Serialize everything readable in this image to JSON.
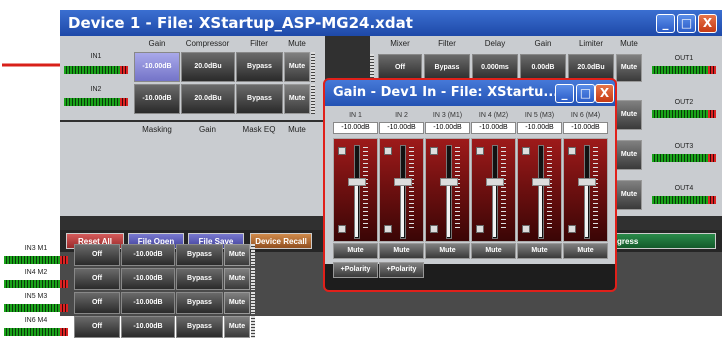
{
  "main_window": {
    "title": "Device 1  -  File: XStartup_ASP-MG24.xdat",
    "controls": {
      "minimize": "_",
      "maximize": "□",
      "close": "X"
    }
  },
  "input_section": {
    "headers": [
      "Gain",
      "Compressor",
      "Filter",
      "Mute"
    ],
    "rows": [
      {
        "name": "IN1",
        "gain": "-10.00dB",
        "compressor": "20.0dBu",
        "filter": "Bypass",
        "mute": "Mute"
      },
      {
        "name": "IN2",
        "gain": "-10.00dB",
        "compressor": "20.0dBu",
        "filter": "Bypass",
        "mute": "Mute"
      }
    ]
  },
  "mic_section": {
    "headers": [
      "Masking",
      "Gain",
      "Mask EQ",
      "Mute"
    ],
    "rows": [
      {
        "name": "IN3 M1",
        "masking": "Off",
        "gain": "-10.00dB",
        "mask_eq": "Bypass",
        "mute": "Mute"
      },
      {
        "name": "IN4 M2",
        "masking": "Off",
        "gain": "-10.00dB",
        "mask_eq": "Bypass",
        "mute": "Mute"
      },
      {
        "name": "IN5 M3",
        "masking": "Off",
        "gain": "-10.00dB",
        "mask_eq": "Bypass",
        "mute": "Mute"
      },
      {
        "name": "IN6 M4",
        "masking": "Off",
        "gain": "-10.00dB",
        "mask_eq": "Bypass",
        "mute": "Mute"
      }
    ]
  },
  "output_section": {
    "headers": [
      "Mixer",
      "Filter",
      "Delay",
      "Gain",
      "Limiter",
      "Mute"
    ],
    "row1": {
      "mixer": "Off",
      "filter": "Bypass",
      "delay": "0.000ms",
      "gain": "0.00dB",
      "limiter": "20.0dBu",
      "mute": "Mute"
    },
    "partial_mutes": [
      "Mute",
      "Mute",
      "Mute"
    ],
    "outputs": [
      "OUT1",
      "OUT2",
      "OUT3",
      "OUT4"
    ]
  },
  "bottom_bar": {
    "reset_all": "Reset All",
    "file_open": "File Open",
    "file_save": "File Save",
    "device_recall": "Device Recall",
    "progress_label": "gress"
  },
  "gain_window": {
    "title": "Gain - Dev1 In  -  File: XStartu...",
    "channels": [
      {
        "label": "IN 1",
        "value": "-10.00dB",
        "mute": "Mute",
        "polarity": "+Polarity",
        "level": 0.62
      },
      {
        "label": "IN 2",
        "value": "-10.00dB",
        "mute": "Mute",
        "polarity": "+Polarity",
        "level": 0.62
      },
      {
        "label": "IN 3 (M1)",
        "value": "-10.00dB",
        "mute": "Mute",
        "level": 0.62
      },
      {
        "label": "IN 4 (M2)",
        "value": "-10.00dB",
        "mute": "Mute",
        "level": 0.62
      },
      {
        "label": "IN 5 (M3)",
        "value": "-10.00dB",
        "mute": "Mute",
        "level": 0.62
      },
      {
        "label": "IN 6 (M4)",
        "value": "-10.00dB",
        "mute": "Mute",
        "level": 0.62
      }
    ]
  },
  "colors": {
    "title_bar": "#2b5cc8",
    "highlight_cell": "#9a9ae0",
    "annotation_arrow": "#d8201a",
    "reset_button": "#b84040",
    "file_button": "#5a5ab0",
    "recall_button": "#b06a30",
    "progress_bar": "#1f6b3a"
  }
}
